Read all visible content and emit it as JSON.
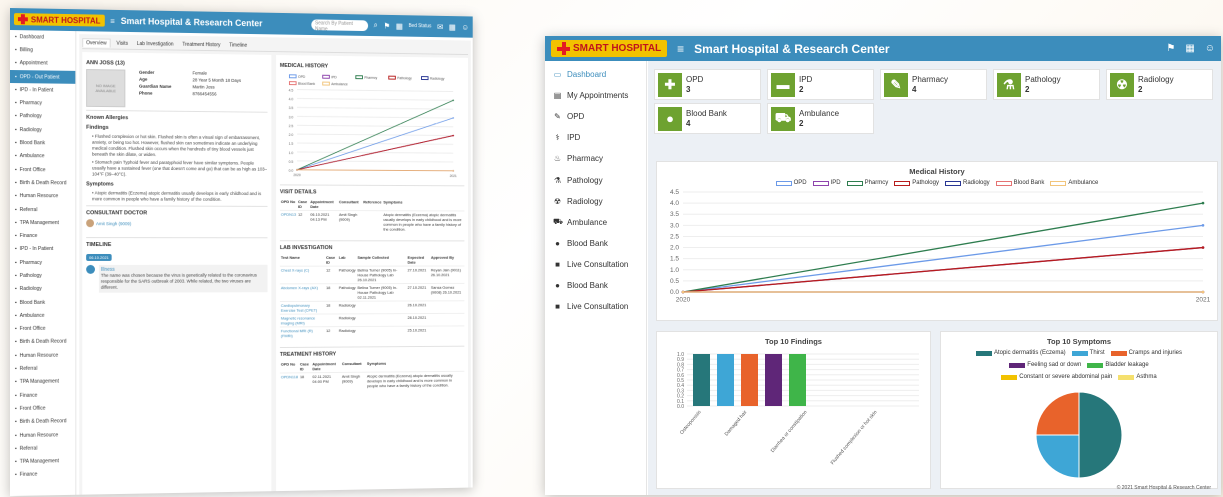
{
  "app_title": "Smart Hospital & Research Center",
  "logo_text": "SMART HOSPITAL",
  "left": {
    "search_placeholder": "Search By Patient Name",
    "status_label": "Bed Status",
    "sidebar": [
      "Dashboard",
      "Billing",
      "Appointment",
      "OPD - Out Patient",
      "IPD - In Patient",
      "Pharmacy",
      "Pathology",
      "Radiology",
      "Blood Bank",
      "Ambulance",
      "Front Office",
      "Birth & Death Record",
      "Human Resource",
      "Referral",
      "TPA Management",
      "Finance",
      "IPD - In Patient",
      "Pharmacy",
      "Pathology",
      "Radiology",
      "Blood Bank",
      "Ambulance",
      "Front Office",
      "Birth & Death Record",
      "Human Resource",
      "Referral",
      "TPA Management",
      "Finance",
      "Front Office",
      "Birth & Death Record",
      "Human Resource",
      "Referral",
      "TPA Management",
      "Finance"
    ],
    "tabs": [
      "Overview",
      "Visits",
      "Lab Investigation",
      "Treatment History",
      "Timeline"
    ],
    "patient_name": "ANN JOSS (13)",
    "photo_text": "NO IMAGE AVAILABLE",
    "patient_fields": [
      {
        "k": "Gender",
        "v": "Female"
      },
      {
        "k": "Age",
        "v": "28 Year 5 Month 18 Days"
      },
      {
        "k": "Guardian Name",
        "v": "Martin Joss"
      },
      {
        "k": "Phone",
        "v": "8766454556"
      }
    ],
    "known_allergies": "Known Allergies",
    "findings_title": "Findings",
    "findings": [
      "Flushed complexion or hot skin. Flushed skin is often a visual sign of embarrassment, anxiety, or being too hot. However, flushed skin can sometimes indicate an underlying medical condition. Flushed skin occurs when the hundreds of tiny blood vessels just beneath the skin dilate, or widen.",
      "Stomach pain Typhoid fever and paratyphoid fever have similar symptoms. People usually have a sustained fever (one that doesn't come and go) that can be as high as 103–104°F (39–40°C)."
    ],
    "symptoms_title": "Symptoms",
    "symptoms": [
      "Atopic dermatitis (Eczema) atopic dermatitis usually develops in early childhood and is more common in people who have a family history of the condition."
    ],
    "consultant_title": "CONSULTANT DOCTOR",
    "consultant": "Amit Singh (9009)",
    "timeline_title": "TIMELINE",
    "timeline_date": "06.10.2021",
    "timeline_event": "Illness",
    "timeline_text": "The name was chosen because the virus is genetically related to the coronavirus responsible for the SARS outbreak of 2003. While related, the two viruses are different.",
    "medical_history_title": "MEDICAL HISTORY",
    "visit_title": "VISIT DETAILS",
    "visit_headers": [
      "OPD No",
      "Case ID",
      "Appointment Date",
      "Consultant",
      "Reference",
      "Symptoms"
    ],
    "visit_rows": [
      [
        "OPDN13",
        "12",
        "06.10.2021 04:13 PM",
        "Amit Singh (9009)",
        "",
        "Atopic dermatitis (Eczema) atopic dermatitis usually develops in early childhood and is more common in people who have a family history of the condition."
      ]
    ],
    "lab_title": "LAB INVESTIGATION",
    "lab_headers": [
      "Test Name",
      "Case ID",
      "Lab",
      "Sample Collected",
      "Expected Date",
      "Approved By"
    ],
    "lab_rows": [
      [
        "Chest X-rays (C)",
        "12",
        "Pathology",
        "Belina Turner (9005) In-House Pathology Lab 26.10.2021",
        "27.10.2021",
        "Reyan Jain (9011) 26.10.2021"
      ],
      [
        "Abdomen X-rays (AX)",
        "18",
        "Pathology",
        "Belina Turner (9005) In-House Pathology Lab 02.11.2021",
        "27.10.2021",
        "Sansa Gomez (9008) 26.10.2021"
      ],
      [
        "Cardiopulmonary Exercise Test (CPET)",
        "18",
        "Radiology",
        "",
        "26.10.2021",
        ""
      ],
      [
        "Magnetic resonance imaging (MRI)",
        "",
        "Radiology",
        "",
        "28.10.2021",
        ""
      ],
      [
        "Functional MRI (R) (FMRI)",
        "12",
        "Radiology",
        "",
        "25.10.2021",
        ""
      ]
    ],
    "treatment_title": "TREATMENT HISTORY",
    "treatment_headers": [
      "OPD No",
      "Case ID",
      "Appointment Date",
      "Consultant",
      "Symptoms"
    ],
    "treatment_rows": [
      [
        "OPDN118",
        "18",
        "02.11.2021 04:00 PM",
        "Amit Singh (9009)",
        "Atopic dermatitis (Eczema) atopic dermatitis usually develops in early childhood and is more common in people who have a family history of the condition."
      ]
    ]
  },
  "right": {
    "sidebar": [
      {
        "label": "Dashboard",
        "icon": "▭"
      },
      {
        "label": "My Appointments",
        "icon": "▤"
      },
      {
        "label": "OPD",
        "icon": "✎"
      },
      {
        "label": "IPD",
        "icon": "⚕"
      },
      {
        "label": "Pharmacy",
        "icon": "♨"
      },
      {
        "label": "Pathology",
        "icon": "⚗"
      },
      {
        "label": "Radiology",
        "icon": "☢"
      },
      {
        "label": "Ambulance",
        "icon": "⛟"
      },
      {
        "label": "Blood Bank",
        "icon": "●"
      },
      {
        "label": "Live Consultation",
        "icon": "■"
      },
      {
        "label": "Blood Bank",
        "icon": "●"
      },
      {
        "label": "Live Consultation",
        "icon": "■"
      }
    ],
    "cards": [
      {
        "label": "OPD",
        "value": "3",
        "icon": "✚"
      },
      {
        "label": "IPD",
        "value": "2",
        "icon": "▬"
      },
      {
        "label": "Pharmacy",
        "value": "4",
        "icon": "✎"
      },
      {
        "label": "Pathology",
        "value": "2",
        "icon": "⚗"
      },
      {
        "label": "Radiology",
        "value": "2",
        "icon": "☢"
      },
      {
        "label": "Blood Bank",
        "value": "4",
        "icon": "●"
      },
      {
        "label": "Ambulance",
        "value": "2",
        "icon": "⛟"
      }
    ],
    "footer": "© 2021 Smart Hospital & Research Center"
  },
  "chart_data": [
    {
      "type": "line",
      "title": "Medical History",
      "x": [
        "2020",
        "2021"
      ],
      "ylim": [
        0,
        4.5
      ],
      "yticks": [
        0,
        0.5,
        1.0,
        1.5,
        2.0,
        2.5,
        3.0,
        3.5,
        4.0,
        4.5
      ],
      "legend": "top",
      "grid": true,
      "series": [
        {
          "name": "OPD",
          "color": "#6c9ae8",
          "values": [
            0,
            3
          ]
        },
        {
          "name": "IPD",
          "color": "#8e44ad",
          "values": [
            0,
            2
          ]
        },
        {
          "name": "Pharmcy",
          "color": "#2e7d4f",
          "values": [
            0,
            4
          ]
        },
        {
          "name": "Pathology",
          "color": "#b71c1c",
          "values": [
            0,
            2
          ]
        },
        {
          "name": "Radiology",
          "color": "#283593",
          "values": [
            0,
            0
          ]
        },
        {
          "name": "Blood Bank",
          "color": "#e57373",
          "values": [
            0,
            0
          ]
        },
        {
          "name": "Ambulance",
          "color": "#f2c57c",
          "values": [
            0,
            0
          ]
        }
      ]
    },
    {
      "type": "bar",
      "title": "Top 10 Findings",
      "categories": [
        "Osteoporosis",
        "Damaged hair",
        "Diarrhea or constipation",
        "Flushed complexion or hot skin"
      ],
      "ylim": [
        0,
        1.0
      ],
      "yticks": [
        0,
        0.1,
        0.2,
        0.3,
        0.4,
        0.5,
        0.6,
        0.7,
        0.8,
        0.9,
        1.0
      ],
      "bars": [
        {
          "value": 1,
          "color": "#26777a"
        },
        {
          "value": 1,
          "color": "#3ea6d6"
        },
        {
          "value": 1,
          "color": "#e8632b"
        },
        {
          "value": 1,
          "color": "#5f2678"
        },
        {
          "value": 1,
          "color": "#3fb549"
        }
      ]
    },
    {
      "type": "pie",
      "title": "Top 10 Symptoms",
      "legend": [
        {
          "name": "Atopic dermatitis (Eczema)",
          "color": "#26777a"
        },
        {
          "name": "Thirst",
          "color": "#3ea6d6"
        },
        {
          "name": "Cramps and injuries",
          "color": "#e8632b"
        },
        {
          "name": "Feeling sad or down",
          "color": "#5f2678"
        },
        {
          "name": "Bladder leakage",
          "color": "#3fb549"
        },
        {
          "name": "Constant or severe abdominal pain",
          "color": "#f2c200"
        },
        {
          "name": "Asthma",
          "color": "#f5e06e"
        }
      ],
      "slices": [
        {
          "name": "Atopic dermatitis (Eczema)",
          "value": 50,
          "color": "#26777a"
        },
        {
          "name": "Thirst",
          "value": 25,
          "color": "#3ea6d6"
        },
        {
          "name": "Cramps and injuries",
          "value": 25,
          "color": "#e8632b"
        }
      ]
    }
  ]
}
